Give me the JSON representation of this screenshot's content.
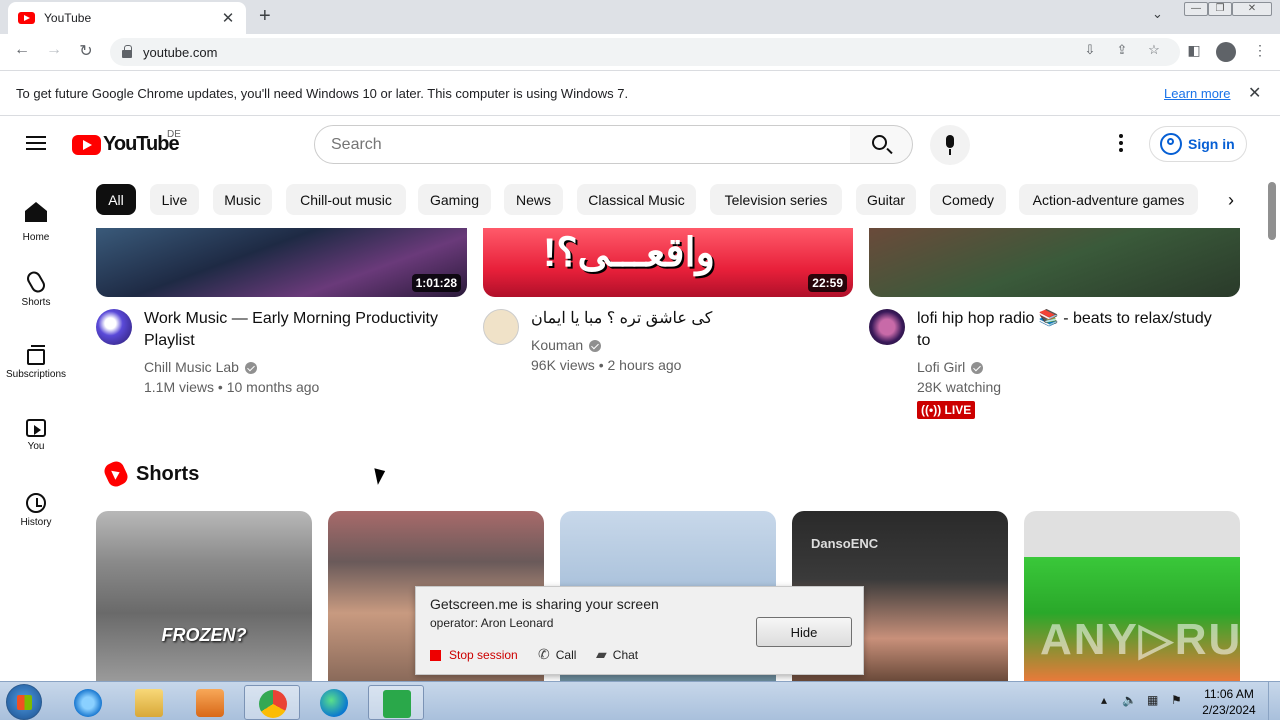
{
  "browser": {
    "tab_title": "YouTube",
    "tab_close": "✕",
    "new_tab": "+",
    "tab_search": "⌄",
    "url": "youtube.com",
    "win_min": "—",
    "win_restore": "❐",
    "win_close": "✕"
  },
  "infobar": {
    "message": "To get future Google Chrome updates, you'll need Windows 10 or later. This computer is using Windows 7.",
    "link": "Learn more",
    "close": "✕"
  },
  "masthead": {
    "logo_text": "YouTube",
    "region": "DE",
    "search_placeholder": "Search",
    "signin": "Sign in"
  },
  "guide": [
    {
      "label": "Home",
      "icon": "home-icon"
    },
    {
      "label": "Shorts",
      "icon": "shorts-icon"
    },
    {
      "label": "Subscriptions",
      "icon": "subscriptions-icon"
    },
    {
      "label": "You",
      "icon": "you-icon"
    },
    {
      "label": "History",
      "icon": "history-icon"
    }
  ],
  "chips": [
    "All",
    "Live",
    "Music",
    "Chill-out music",
    "Gaming",
    "News",
    "Classical Music",
    "Television series",
    "Guitar",
    "Comedy",
    "Action-adventure games"
  ],
  "videos": [
    {
      "duration": "1:01:28",
      "title_line1": "Work Music — Early Morning Productivity",
      "title_line2": "Playlist",
      "channel": "Chill Music Lab",
      "meta": "1.1M views • 10 months ago"
    },
    {
      "duration": "22:59",
      "thumb_text": "واقعـــی؟!",
      "title_line1": "کی عاشق تره ؟ مبا یا ایمان",
      "channel": "Kouman",
      "meta": "96K views • 2 hours ago"
    },
    {
      "title_line1": "lofi hip hop radio 📚 - beats to relax/study",
      "title_line2": "to",
      "channel": "Lofi Girl",
      "meta": "28K watching",
      "badge": "LIVE"
    }
  ],
  "shorts": {
    "title": "Shorts",
    "card1_text": "FROZEN?",
    "card4_text": "DansoENC"
  },
  "share_popup": {
    "line1": "Getscreen.me is sharing your screen",
    "line2": "operator: Aron Leonard",
    "hide": "Hide",
    "stop": "Stop session",
    "call": "Call",
    "chat": "Chat"
  },
  "watermark": "ANY▷RUN",
  "taskbar": {
    "time": "11:06 AM",
    "date": "2/23/2024"
  }
}
